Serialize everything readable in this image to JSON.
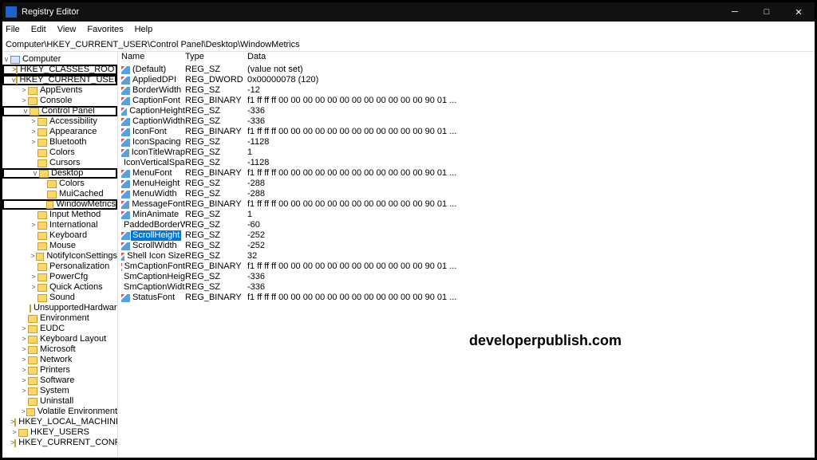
{
  "window": {
    "title": "Registry Editor"
  },
  "menu": [
    "File",
    "Edit",
    "View",
    "Favorites",
    "Help"
  ],
  "address": "Computer\\HKEY_CURRENT_USER\\Control Panel\\Desktop\\WindowMetrics",
  "tree": {
    "root": "Computer",
    "hkcr": "HKEY_CLASSES_ROOT",
    "hkcu": "HKEY_CURRENT_USER",
    "cp": "Control Panel",
    "desktop": "Desktop",
    "wm": "WindowMetrics",
    "kids": {
      "appEvents": "AppEvents",
      "console": "Console",
      "accessibility": "Accessibility",
      "appearance": "Appearance",
      "bluetooth": "Bluetooth",
      "colors": "Colors",
      "cursors": "Cursors",
      "colors2": "Colors",
      "muicached": "MuiCached",
      "inputMethod": "Input Method",
      "international": "International",
      "keyboard": "Keyboard",
      "mouse": "Mouse",
      "notifyIcon": "NotifyIconSettings",
      "personalization": "Personalization",
      "powerCfg": "PowerCfg",
      "quickActions": "Quick Actions",
      "sound": "Sound",
      "unsupported": "UnsupportedHardwareN"
    },
    "kids2": {
      "environment": "Environment",
      "eudc": "EUDC",
      "kbdlayout": "Keyboard Layout",
      "microsoft": "Microsoft",
      "network": "Network",
      "printers": "Printers",
      "software": "Software",
      "system": "System",
      "uninstall": "Uninstall",
      "volatile": "Volatile Environment"
    },
    "hklm": "HKEY_LOCAL_MACHINE",
    "hku": "HKEY_USERS",
    "hkcc": "HKEY_CURRENT_CONFIG"
  },
  "columns": {
    "name": "Name",
    "type": "Type",
    "data": "Data"
  },
  "values": [
    {
      "n": "(Default)",
      "t": "REG_SZ",
      "d": "(value not set)"
    },
    {
      "n": "AppliedDPI",
      "t": "REG_DWORD",
      "d": "0x00000078 (120)"
    },
    {
      "n": "BorderWidth",
      "t": "REG_SZ",
      "d": "-12"
    },
    {
      "n": "CaptionFont",
      "t": "REG_BINARY",
      "d": "f1 ff ff ff 00 00 00 00 00 00 00 00 00 00 00 00 90 01 ..."
    },
    {
      "n": "CaptionHeight",
      "t": "REG_SZ",
      "d": "-336"
    },
    {
      "n": "CaptionWidth",
      "t": "REG_SZ",
      "d": "-336"
    },
    {
      "n": "IconFont",
      "t": "REG_BINARY",
      "d": "f1 ff ff ff 00 00 00 00 00 00 00 00 00 00 00 00 90 01 ..."
    },
    {
      "n": "IconSpacing",
      "t": "REG_SZ",
      "d": "-1128"
    },
    {
      "n": "IconTitleWrap",
      "t": "REG_SZ",
      "d": "1"
    },
    {
      "n": "IconVerticalSpaci...",
      "t": "REG_SZ",
      "d": "-1128"
    },
    {
      "n": "MenuFont",
      "t": "REG_BINARY",
      "d": "f1 ff ff ff 00 00 00 00 00 00 00 00 00 00 00 00 90 01 ..."
    },
    {
      "n": "MenuHeight",
      "t": "REG_SZ",
      "d": "-288"
    },
    {
      "n": "MenuWidth",
      "t": "REG_SZ",
      "d": "-288"
    },
    {
      "n": "MessageFont",
      "t": "REG_BINARY",
      "d": "f1 ff ff ff 00 00 00 00 00 00 00 00 00 00 00 00 90 01 ..."
    },
    {
      "n": "MinAnimate",
      "t": "REG_SZ",
      "d": "1"
    },
    {
      "n": "PaddedBorderWi...",
      "t": "REG_SZ",
      "d": "-60"
    },
    {
      "n": "ScrollHeight",
      "t": "REG_SZ",
      "d": "-252",
      "sel": true
    },
    {
      "n": "ScrollWidth",
      "t": "REG_SZ",
      "d": "-252"
    },
    {
      "n": "Shell Icon Size",
      "t": "REG_SZ",
      "d": "32"
    },
    {
      "n": "SmCaptionFont",
      "t": "REG_BINARY",
      "d": "f1 ff ff ff 00 00 00 00 00 00 00 00 00 00 00 00 90 01 ..."
    },
    {
      "n": "SmCaptionHeight",
      "t": "REG_SZ",
      "d": "-336"
    },
    {
      "n": "SmCaptionWidth",
      "t": "REG_SZ",
      "d": "-336"
    },
    {
      "n": "StatusFont",
      "t": "REG_BINARY",
      "d": "f1 ff ff ff 00 00 00 00 00 00 00 00 00 00 00 00 90 01 ..."
    }
  ],
  "watermark": "developerpublish.com"
}
